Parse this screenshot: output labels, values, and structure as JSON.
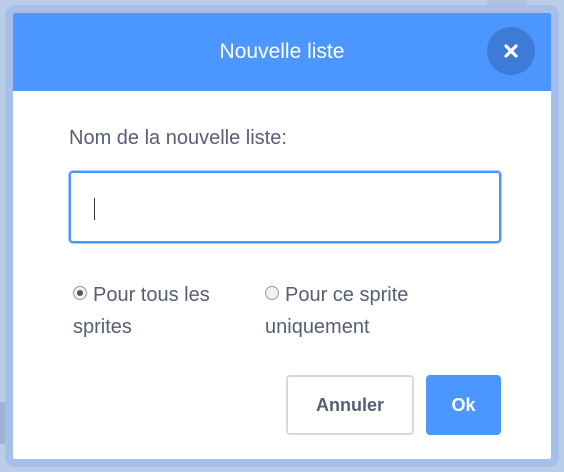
{
  "dialog": {
    "title": "Nouvelle liste",
    "close_icon": "close-icon"
  },
  "form": {
    "label": "Nom de la nouvelle liste:",
    "input_value": ""
  },
  "scope_options": [
    {
      "label": "Pour tous les sprites",
      "selected": true
    },
    {
      "label": "Pour ce sprite uniquement",
      "selected": false
    }
  ],
  "buttons": {
    "cancel_label": "Annuler",
    "ok_label": "Ok"
  },
  "colors": {
    "header": "#4c97ff",
    "close_button": "#3d7bd6",
    "primary_button": "#4c97ff",
    "text": "#575e75"
  }
}
